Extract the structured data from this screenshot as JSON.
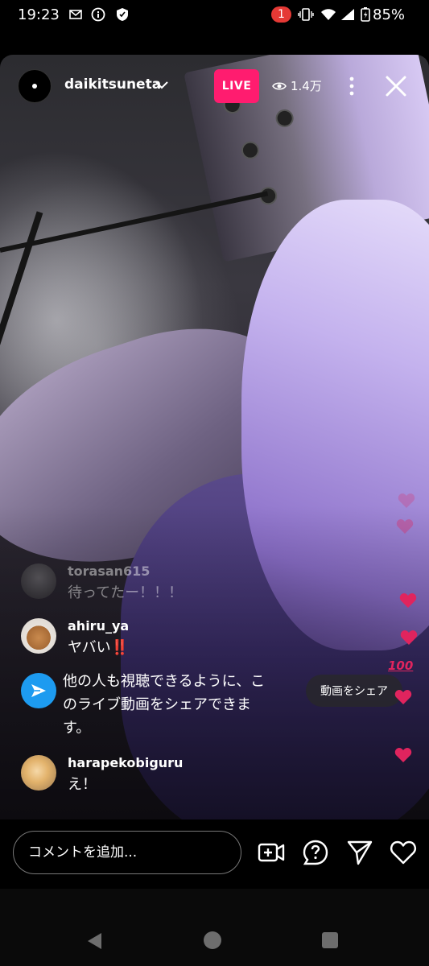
{
  "status_bar": {
    "time": "19:23",
    "icons": [
      "mail-icon",
      "info-icon",
      "shield-icon"
    ],
    "notification_count": "1",
    "battery": "85%"
  },
  "live": {
    "username": "daikitsuneta",
    "badge": "LIVE",
    "viewer_count": "1.4万"
  },
  "comments": [
    {
      "user": "torasan615",
      "text": "待ってたー！！！"
    },
    {
      "user": "ahiru_ya",
      "text": "ヤバい‼️"
    },
    {
      "user": "harapekobiguru",
      "text": "え！"
    }
  ],
  "share_prompt": {
    "lines": [
      "他の人も視聴できるように、こ",
      "のライブ動画をシェアできま",
      "す。"
    ],
    "button": "動画をシェア"
  },
  "bottom": {
    "comment_placeholder": "コメントを追加..."
  },
  "colors": {
    "live_badge": "#ff1c6f",
    "share_icon": "#1d9bf0",
    "heart": "#e0245e"
  }
}
